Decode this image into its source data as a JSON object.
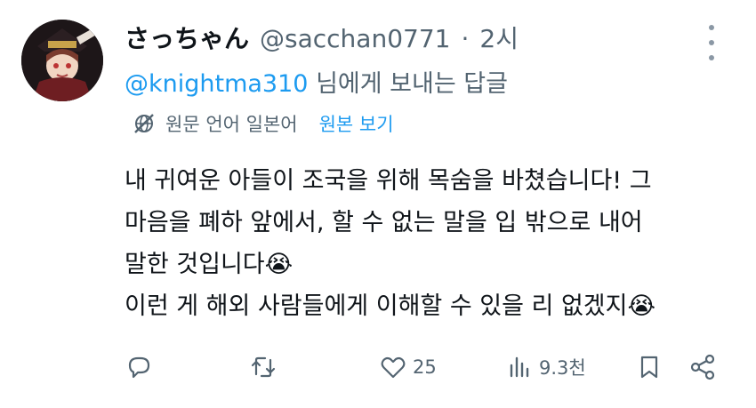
{
  "post": {
    "display_name": "さっちゃん",
    "handle": "@sacchan0771",
    "separator": "·",
    "time": "2시",
    "reply_to_handle": "@knightma310",
    "reply_to_suffix": "님에게 보내는 답글",
    "translation": {
      "source_language_text": "원문 언어 일본어",
      "view_original_label": "원본 보기"
    },
    "body_lines": [
      "내 귀여운 아들이 조국을 위해 목숨을 바쳤습니다! 그",
      "마음을 폐하 앞에서, 할 수 없는 말을 입 밖으로 내어",
      "말한 것입니다😭",
      "이런 게 해외 사람들에게 이해할 수 있을 리 없겠지😭"
    ],
    "actions": {
      "reply_count": "",
      "repost_count": "",
      "like_count": "25",
      "views_count": "9.3천"
    }
  },
  "icons": {
    "more": "more-dots-icon",
    "translate": "translate-globe-icon",
    "reply": "reply-icon",
    "repost": "repost-icon",
    "like": "heart-icon",
    "views": "views-chart-icon",
    "bookmark": "bookmark-icon",
    "share": "share-icon"
  },
  "colors": {
    "link_blue": "#1d9bf0",
    "secondary_text": "#536471",
    "primary_text": "#0f1419"
  }
}
